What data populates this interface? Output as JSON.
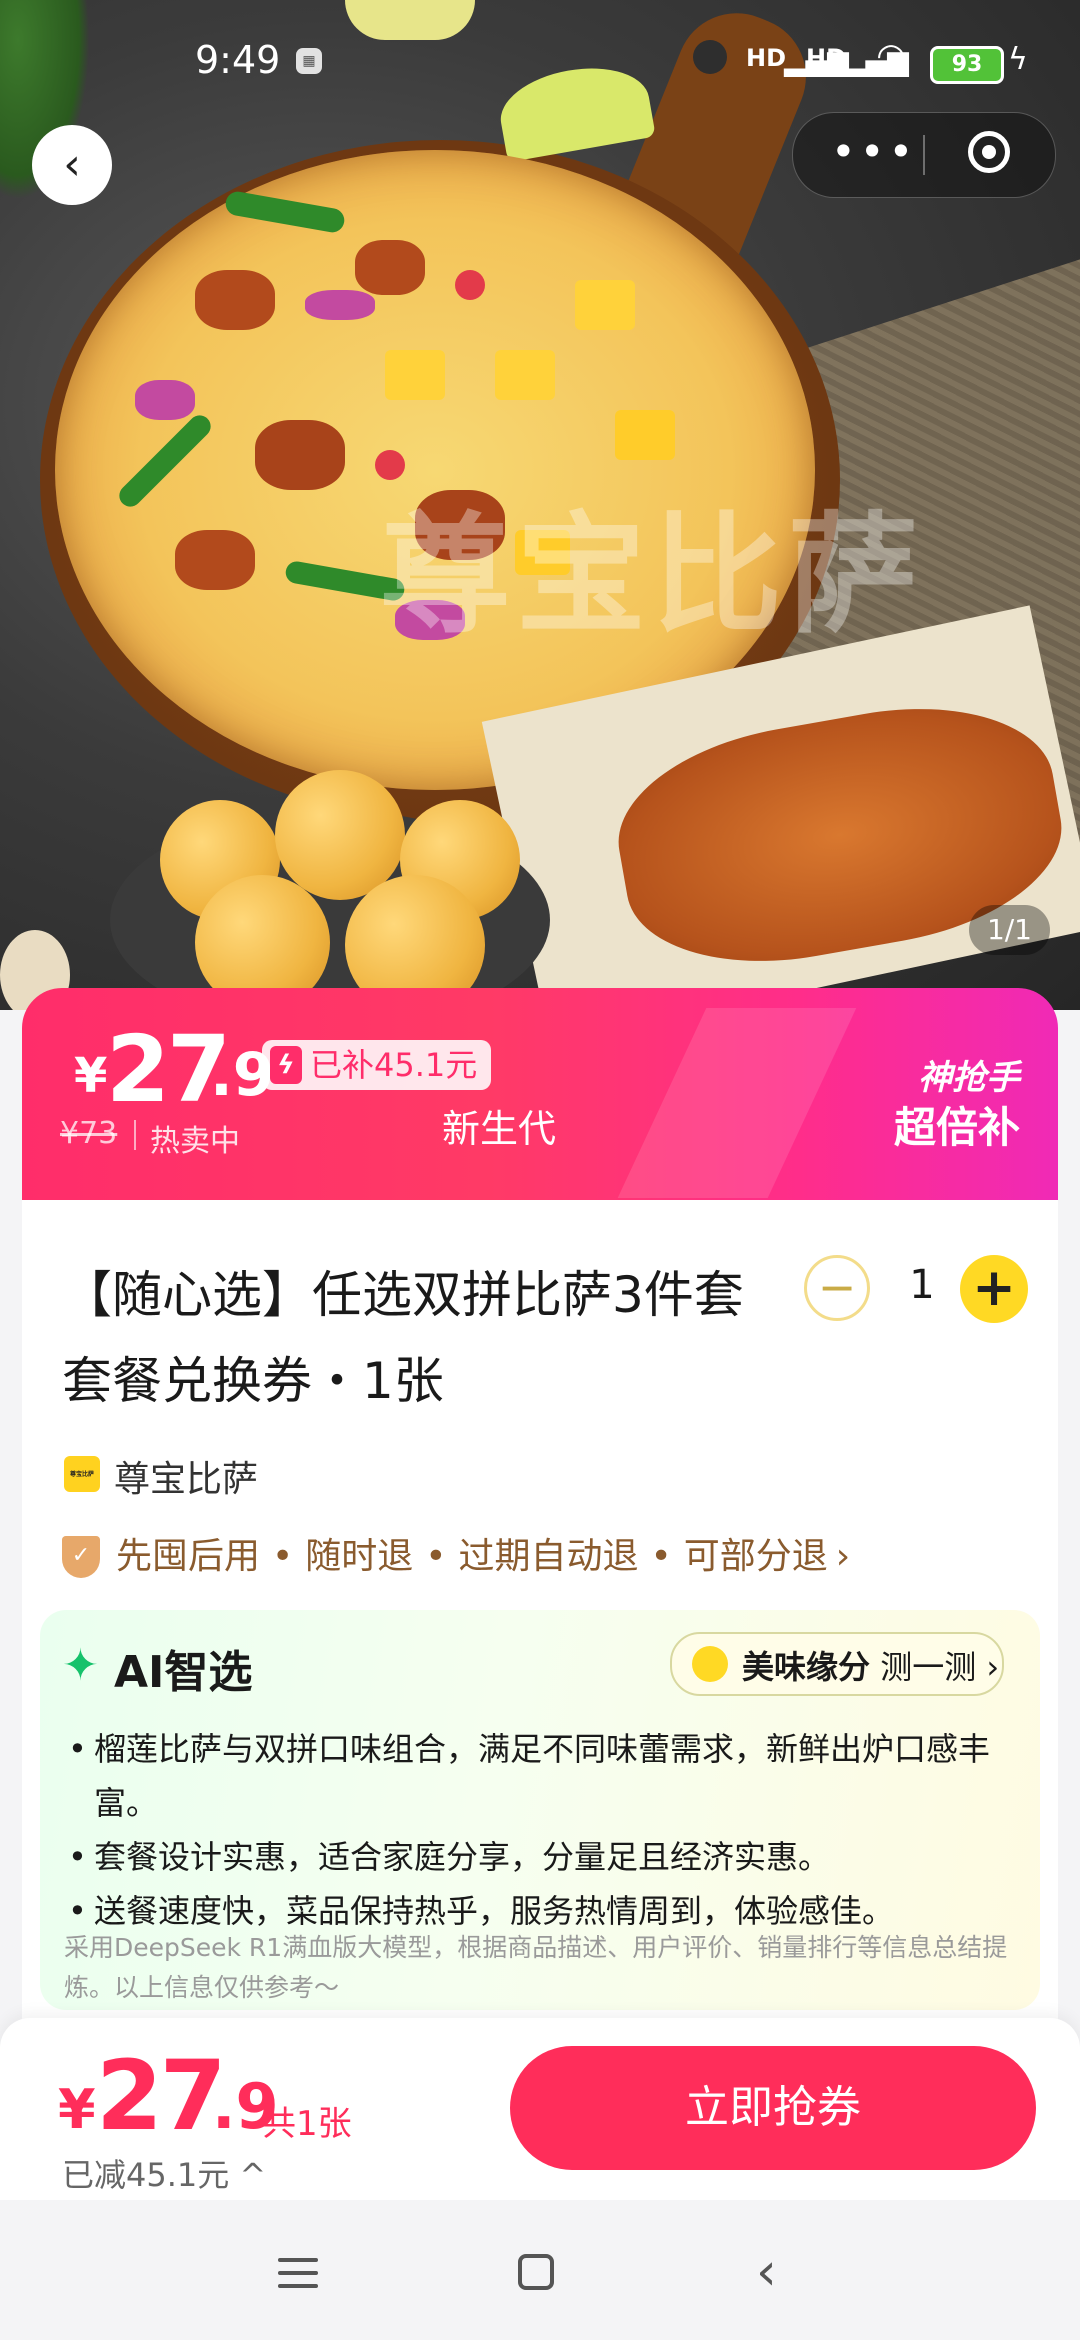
{
  "status_bar": {
    "time": "9:49",
    "signal1": "HD",
    "signal2": "HD",
    "battery": "93"
  },
  "hero": {
    "watermark": "尊宝比萨",
    "image_counter": "1/1"
  },
  "price_banner": {
    "currency": "¥",
    "price_int": "27",
    "price_dec": ".9",
    "subsidy": "已补45.1元",
    "original_price": "¥73",
    "sale_status": "热卖中",
    "tag": "新生代",
    "promo_line1": "神抢手",
    "promo_line2": "超倍补"
  },
  "product": {
    "title": "【随心选】任选双拼比萨3件套套餐兑换券・1张",
    "quantity": "1",
    "shop_logo_text": "尊宝比萨",
    "shop_name": "尊宝比萨",
    "services": [
      "先囤后用",
      "随时退",
      "过期自动退",
      "可部分退"
    ]
  },
  "ai": {
    "title": "AI智选",
    "pill_bold": "美味缘分",
    "pill_text": "测一测",
    "points": [
      "榴莲比萨与双拼口味组合，满足不同味蕾需求，新鲜出炉口感丰富。",
      "套餐设计实惠，适合家庭分享，分量足且经济实惠。",
      "送餐速度快，菜品保持热乎，服务热情周到，体验感佳。"
    ],
    "note": "采用DeepSeek R1满血版大模型，根据商品描述、用户评价、销量排行等信息总结提炼。以上信息仅供参考～"
  },
  "bottom_bar": {
    "currency": "¥",
    "price_int": "27",
    "price_dec": ".9",
    "count": "共1张",
    "saved": "已减45.1元 ^",
    "buy_button": "立即抢券"
  },
  "colors": {
    "accent": "#ff2d5a",
    "banner_end": "#f02ab6",
    "ai_green": "#16c26b",
    "qty_yellow": "#ffd924"
  }
}
